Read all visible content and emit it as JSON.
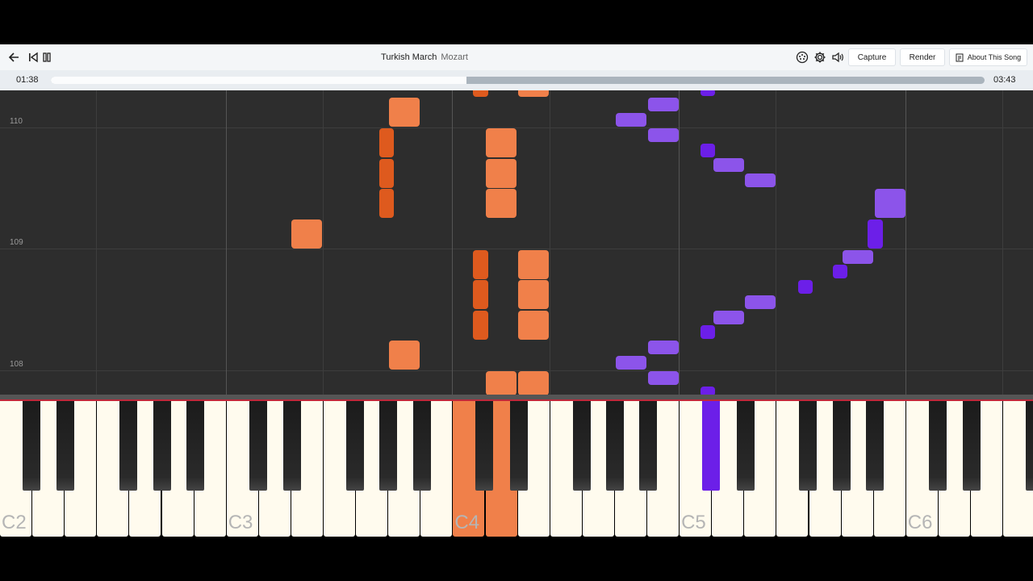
{
  "song": {
    "title": "Turkish March",
    "composer": "Mozart"
  },
  "toolbar": {
    "back_icon": "arrow-left-icon",
    "restart_icon": "skip-back-icon",
    "pause_icon": "pause-icon",
    "midi_icon": "midi-port-icon",
    "settings_icon": "gear-icon",
    "volume_icon": "speaker-icon",
    "capture_label": "Capture",
    "render_label": "Render",
    "about_label": "About This Song",
    "about_icon": "info-sheet-icon"
  },
  "playback": {
    "current_time": "01:38",
    "total_time": "03:43",
    "progress": 0.445
  },
  "measures": [
    "110",
    "109",
    "108"
  ],
  "key_labels": [
    "C2",
    "C3",
    "C4",
    "C5",
    "C6"
  ],
  "colors": {
    "right_hand": "#f0804a",
    "right_hand_dark": "#de5a1e",
    "left_hand": "#8c54ea",
    "left_hand_dark": "#6c1fe8",
    "roll_bg": "#2d2d2d",
    "played_line": "#c0283a"
  },
  "active_keys": [
    {
      "key": "C4",
      "hand": "right"
    },
    {
      "key": "D4",
      "hand": "right"
    },
    {
      "key": "C#5",
      "hand": "left"
    }
  ]
}
